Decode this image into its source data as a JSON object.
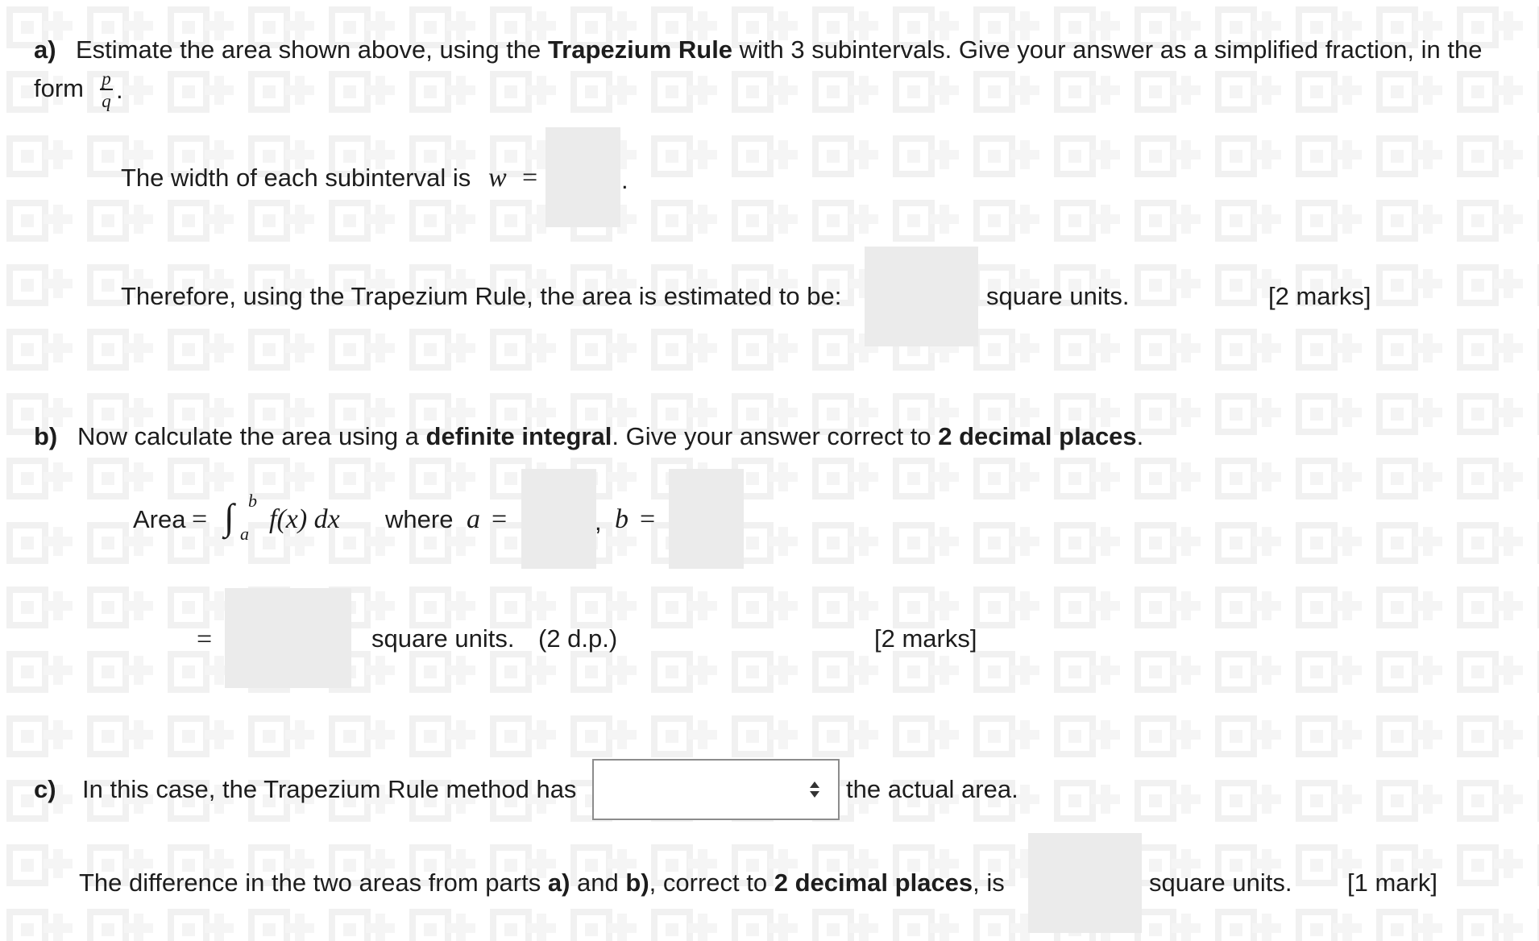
{
  "part_a": {
    "label": "a)",
    "text1": "Estimate the area shown above, using the",
    "bold1": "Trapezium Rule",
    "text2": "with 3 subintervals. Give your answer as a simplified fraction, in the",
    "text3": "form",
    "frac_p": "p",
    "frac_q": "q",
    "text4": ".",
    "width_line": "The width of each subinterval is",
    "width_var": "w",
    "equals": "=",
    "width_end": ".",
    "therefore_line": "Therefore, using the Trapezium Rule, the area is estimated to be:",
    "units": "square units.",
    "marks": "[2 marks]"
  },
  "part_b": {
    "label": "b)",
    "text1": "Now calculate the area using a",
    "bold1": "definite integral",
    "text2": ". Give your answer correct to",
    "bold2": "2 decimal places",
    "text3": ".",
    "area_label": "Area",
    "equals": "=",
    "integral_sign": "∫",
    "upper": "b",
    "lower": "a",
    "integrand": "f(x) dx",
    "where": "where",
    "a_var": "a",
    "comma": ",",
    "b_var": "b",
    "result_equals": "=",
    "units": "square units.",
    "dp": "(2 d.p.)",
    "marks": "[2 marks]"
  },
  "part_c": {
    "label": "c)",
    "text1": "In this case, the Trapezium Rule method has",
    "select_value": "",
    "text2": "the actual area.",
    "diff_text1": "The difference in the two areas from parts",
    "diff_bold_a": "a)",
    "diff_and": "and",
    "diff_bold_b": "b)",
    "diff_text2": ", correct to",
    "diff_bold_dp": "2 decimal places",
    "diff_text3": ", is",
    "units": "square units.",
    "marks": "[1 mark]"
  },
  "colors": {
    "text": "#1d1d1d",
    "input_bg": "#ebebeb",
    "select_border": "#8c8c8c",
    "background": "#ffffff",
    "pattern": "#f3f3f3"
  }
}
